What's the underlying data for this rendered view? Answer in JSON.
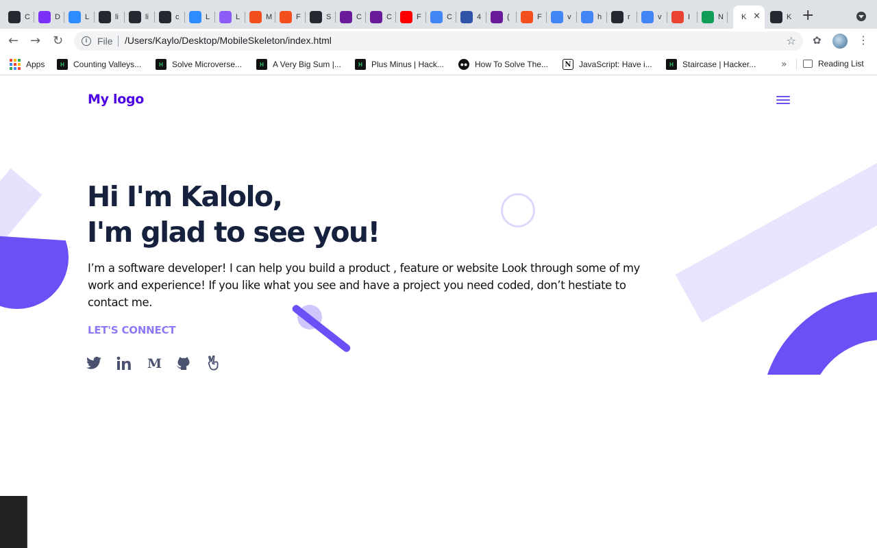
{
  "browser": {
    "tabs": [
      {
        "icon": "github-icon",
        "letter": "C",
        "color": "#24292f"
      },
      {
        "icon": "figma-icon",
        "letter": "D",
        "color": "#7b2ff7"
      },
      {
        "icon": "zoom-icon",
        "letter": "L",
        "color": "#2d8cff"
      },
      {
        "icon": "github-icon",
        "letter": "li",
        "color": "#24292f"
      },
      {
        "icon": "github-icon",
        "letter": "li",
        "color": "#24292f"
      },
      {
        "icon": "github-icon",
        "letter": "c",
        "color": "#24292f"
      },
      {
        "icon": "zoom-icon",
        "letter": "L",
        "color": "#2d8cff"
      },
      {
        "icon": "gear-icon",
        "letter": "L",
        "color": "#8b5cf6"
      },
      {
        "icon": "figma-icon",
        "letter": "M",
        "color": "#f24e1e"
      },
      {
        "icon": "figma-icon",
        "letter": "F",
        "color": "#f24e1e"
      },
      {
        "icon": "github-icon",
        "letter": "S",
        "color": "#24292f"
      },
      {
        "icon": "list-icon",
        "letter": "C",
        "color": "#6a1b9a"
      },
      {
        "icon": "list-icon",
        "letter": "C",
        "color": "#6a1b9a"
      },
      {
        "icon": "youtube-icon",
        "letter": "F",
        "color": "#ff0000"
      },
      {
        "icon": "docs-icon",
        "letter": "C",
        "color": "#4285f4"
      },
      {
        "icon": "ku-icon",
        "letter": "4",
        "color": "#3054a5"
      },
      {
        "icon": "mail-icon",
        "letter": "(",
        "color": "#6a1b9a"
      },
      {
        "icon": "figma-icon",
        "letter": "F",
        "color": "#f24e1e"
      },
      {
        "icon": "google-icon",
        "letter": "v",
        "color": "#4285f4"
      },
      {
        "icon": "google-icon",
        "letter": "h",
        "color": "#4285f4"
      },
      {
        "icon": "github-icon",
        "letter": "r",
        "color": "#24292f"
      },
      {
        "icon": "google-icon",
        "letter": "v",
        "color": "#4285f4"
      },
      {
        "icon": "gmail-icon",
        "letter": "I",
        "color": "#ea4335"
      },
      {
        "icon": "drive-icon",
        "letter": "N",
        "color": "#0f9d58"
      }
    ],
    "active_tab": {
      "letter": "K",
      "close": "×"
    },
    "after_tab": {
      "icon": "github-icon",
      "letter": "K",
      "color": "#24292f"
    },
    "new_tab": "+",
    "url_scheme": "File",
    "url": "/Users/Kaylo/Desktop/MobileSkeleton/index.html",
    "bookmarks": [
      {
        "label": "Apps",
        "kind": "apps"
      },
      {
        "label": "Counting Valleys...",
        "kind": "hr"
      },
      {
        "label": "Solve Microverse...",
        "kind": "hr"
      },
      {
        "label": "A Very Big Sum |...",
        "kind": "hr"
      },
      {
        "label": "Plus Minus | Hack...",
        "kind": "hr"
      },
      {
        "label": "How To Solve The...",
        "kind": "md"
      },
      {
        "label": "JavaScript: Have i...",
        "kind": "notion"
      },
      {
        "label": "Staircase | Hacker...",
        "kind": "hr"
      }
    ],
    "bookmarks_more": "»",
    "reading_list": "Reading List"
  },
  "page": {
    "logo": "My logo",
    "hero": {
      "line1": "Hi I'm Kalolo,",
      "line2": "I'm glad to see you!",
      "body": "I’m a software developer! I can help you build a product , feature or website Look through some of my work and experience! If you like what you see and have a project you need coded, don’t hestiate to contact me."
    },
    "cta": "LET'S CONNECT",
    "socials": [
      "twitter-icon",
      "linkedin-icon",
      "medium-icon",
      "github-icon",
      "angellist-icon"
    ],
    "colors": {
      "brand": "#4c00e6",
      "accent": "#6c4ff5",
      "accent_light": "#e6e2fd",
      "heading": "#16213e",
      "cta": "#8b7af5",
      "social": "#4a5270"
    }
  }
}
